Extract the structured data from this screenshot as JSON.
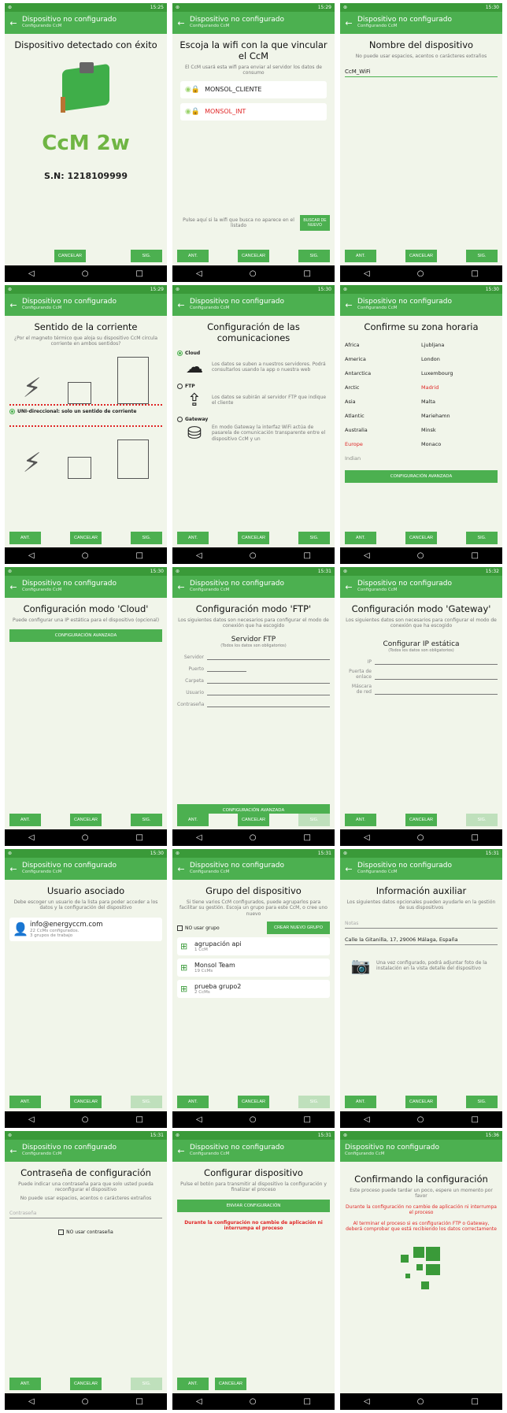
{
  "status_times": [
    "15:25",
    "15:29",
    "15:30",
    "15:29",
    "15:30",
    "15:30",
    "15:30",
    "15:31",
    "15:32",
    "15:30",
    "15:31",
    "15:31",
    "15:31",
    "15:31",
    "15:36"
  ],
  "appbar": {
    "title": "Dispositivo no configurado",
    "subtitle": "Configurando CcM"
  },
  "buttons": {
    "ant": "ANT.",
    "cancelar": "CANCELAR",
    "sig": "SIG."
  },
  "s1": {
    "title": "Dispositivo detectado con éxito",
    "logo": "CcM 2w",
    "serial": "S.N: 1218109999"
  },
  "s2": {
    "title": "Escoja la wifi con la que vincular el CcM",
    "sub": "El CcM usará esta wifi para enviar al servidor los datos de consumo",
    "wifis": [
      "MONSOL_CLIENTE",
      "MONSOL_INT"
    ],
    "note": "Pulse aquí si la wifi que busca no aparece en el listado",
    "search": "BUSCAR DE NUEVO"
  },
  "s3": {
    "title": "Nombre del dispositivo",
    "sub": "No puede usar espacios, acentos o carácteres extraños",
    "value": "CcM_WiFi"
  },
  "s4": {
    "title": "Sentido de la corriente",
    "sub": "¿Por el magneto térmico que aloja su dispositivo CcM circula corriente en ambos sentidos?",
    "opt1": "UNI-direccional: solo un sentido de corriente"
  },
  "s5": {
    "title": "Configuración de las comunicaciones",
    "cloud": "Cloud",
    "cloud_desc": "Los datos se suben a nuestros servidores. Podrá consultarlos usando la app o nuestra web",
    "ftp": "FTP",
    "ftp_desc": "Los datos se subirán al servidor FTP que indique el cliente",
    "gateway": "Gateway",
    "gateway_desc": "En modo Gateway la interfaz WiFi actúa de pasarela de comunicación transparente entre el dispositivo CcM y un"
  },
  "s6": {
    "title": "Confirme su zona horaria",
    "col1": [
      "Africa",
      "America",
      "Antarctica",
      "Arctic",
      "Asia",
      "Atlantic",
      "Australia",
      "Europe",
      "Indian"
    ],
    "col2": [
      "Ljubljana",
      "London",
      "Luxembourg",
      "Madrid",
      "Malta",
      "Mariehamn",
      "Minsk",
      "Monaco"
    ],
    "adv": "CONFIGURACIÓN AVANZADA"
  },
  "s7": {
    "title": "Configuración modo 'Cloud'",
    "sub": "Puede configurar una IP estática para el dispositivo (opcional)",
    "adv": "CONFIGURACIÓN AVANZADA"
  },
  "s8": {
    "title": "Configuración modo 'FTP'",
    "sub": "Los siguientes datos son necesarios para configurar el modo de conexión que ha escogido",
    "section": "Servidor FTP",
    "section_sub": "(Todos los datos son obligatorios)",
    "fields": [
      "Servidor",
      "Puerto",
      "Carpeta",
      "Usuario",
      "Contraseña"
    ],
    "adv": "CONFIGURACIÓN AVANZADA"
  },
  "s9": {
    "title": "Configuración modo 'Gateway'",
    "sub": "Los siguientes datos son necesarios para configurar el modo de conexión que ha escogido",
    "section": "Configurar IP estática",
    "section_sub": "(Todos los datos son obligatorios)",
    "fields": [
      "IP",
      "Puerta de enlace",
      "Máscara de red"
    ]
  },
  "s10": {
    "title": "Usuario asociado",
    "sub": "Debe escoger un usuario de la lista para poder acceder a los datos y la configuración del dispositivo",
    "email": "info@energyccm.com",
    "line1": "22 CcMs configurados.",
    "line2": "3 grupos de trabajo"
  },
  "s11": {
    "title": "Grupo del dispositivo",
    "sub": "Si tiene varios CcM configurados, puede agruparlos para facilitar su gestión. Escoja un grupo para este CcM, o cree uno nuevo",
    "nogroup": "NO usar grupo",
    "create": "CREAR NUEVO GRUPO",
    "groups": [
      {
        "name": "agrupación api",
        "count": "1 CcM"
      },
      {
        "name": "Monsol Team",
        "count": "19 CcMs"
      },
      {
        "name": "prueba grupo2",
        "count": "2 CcMs"
      }
    ]
  },
  "s12": {
    "title": "Información auxiliar",
    "sub": "Los siguientes datos opcionales pueden ayudarle en la gestión de sus dispositivos",
    "notes_ph": "Notas",
    "address": "Calle la Gitanilla, 17, 29006 Málaga, España",
    "photo": "Una vez configurado, podrá adjuntar foto de la instalación en la vista detalle del dispositivo"
  },
  "s13": {
    "title": "Contraseña de configuración",
    "sub": "Puede indicar una contraseña para que solo usted pueda reconfigurar el dispositivo",
    "sub2": "No puede usar espacios, acentos o carácteres extraños",
    "ph": "Contraseña",
    "nopass": "NO usar contraseña"
  },
  "s14": {
    "title": "Configurar dispositivo",
    "sub": "Pulse el botón para transmitir al dispositivo la configuración y finalizar el proceso",
    "send": "ENVIAR CONFIGURACIÓN",
    "warn": "Durante la configuración no cambie de aplicación ni interrumpa el proceso"
  },
  "s15": {
    "title": "Confirmando la configuración",
    "sub": "Este proceso puede tardar un poco, espere un momento por favor",
    "warn1": "Durante la configuración no cambie de aplicación ni interrumpa el proceso",
    "warn2": "Al terminar el proceso si es configuración FTP o Gateway, deberá comprobar que está recibiendo los datos correctamente"
  },
  "colors": {
    "primary": "#4cb050",
    "dark": "#3a9a39",
    "bg": "#f1f5ea",
    "warn": "#e02727"
  }
}
